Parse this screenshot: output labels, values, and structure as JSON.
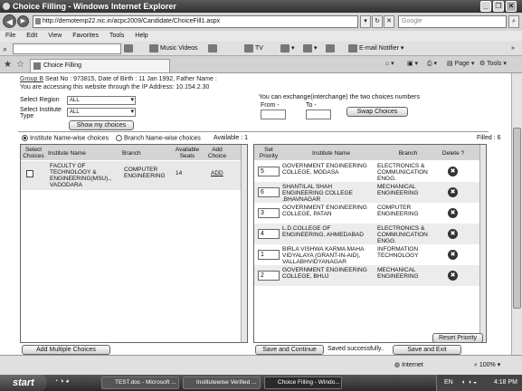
{
  "window": {
    "title": "Choice Filling - Windows Internet Explorer"
  },
  "address": {
    "url": "http://demotemp22.nic.in/acpc2009/Candidate/ChoiceFill1.aspx",
    "search_placeholder": "Google"
  },
  "menu": [
    "File",
    "Edit",
    "View",
    "Favorites",
    "Tools",
    "Help"
  ],
  "toolbar": {
    "music_videos": "Music Videos",
    "tv": "TV",
    "email_notifier": "E-mail Notifier"
  },
  "tab": {
    "title": "Choice Filling"
  },
  "commandbar": {
    "page": "Page",
    "tools": "Tools"
  },
  "info": {
    "group": "Group B",
    "line1_rest": " Seat No : 973815,    Date of Birth : 11 Jan 1992,   Father Name :",
    "line2": "You are accessing this website through the IP Address: 10.154.2.30"
  },
  "filters": {
    "region_label": "Select Region",
    "region_value": "ALL",
    "inst_type_label_1": "Select Institute",
    "inst_type_label_2": "Type",
    "inst_type_value": "ALL",
    "show_button": "Show my choices"
  },
  "exchange": {
    "note": "You can exchange(interchange) the two choices numbers",
    "from_label": "From -",
    "to_label": "To -",
    "swap_button": "Swap Choices"
  },
  "radios": {
    "institute_wise": "Institute Name-wise choices",
    "branch_wise": "Branch Name-wise choices",
    "available": "Available : 1",
    "filled": "Filled : 6"
  },
  "available_table": {
    "headers": [
      "Select\nChoices",
      "Institute Name",
      "Branch",
      "Available\nSeats",
      "Add\nChoice"
    ],
    "rows": [
      {
        "institute": "FACULTY OF TECHNOLOGY & ENGINEERING(MSU)., VADODARA",
        "branch": "COMPUTER ENGINEERING",
        "seats": "14",
        "add": "ADD"
      }
    ]
  },
  "choices_table": {
    "headers": [
      "Set\nPriority",
      "Institute Name",
      "Branch",
      "Delete ?"
    ],
    "rows": [
      {
        "priority": "5",
        "institute": "GOVERNMENT ENGINEERING COLLEGE, MODASA",
        "branch": "ELECTRONICS & COMMUNICATION ENGG."
      },
      {
        "priority": "6",
        "institute": "SHANTILAL SHAH ENGINEERING COLLEGE ,BHAVNAGAR",
        "branch": "MECHANICAL ENGINEERING"
      },
      {
        "priority": "3",
        "institute": "GOVERNMENT ENGINEERING COLLEGE, PATAN",
        "branch": "COMPUTER ENGINEERING"
      },
      {
        "priority": "4",
        "institute": "L.D.COLLEGE OF ENGINEERING, AHMEDABAD",
        "branch": "ELECTRONICS & COMMUNICATION ENGG."
      },
      {
        "priority": "1",
        "institute": "BIRLA VISHWA KARMA MAHA VIDYALAYA (GRANT-IN-AID), VALLABHVIDYANAGAR",
        "branch": "INFORMATION TECHNOLOGY"
      },
      {
        "priority": "2",
        "institute": "GOVERNMENT ENGINEERING COLLEGE, BHUJ",
        "branch": "MECHANICAL ENGINEERING"
      }
    ]
  },
  "actions": {
    "add_multiple": "Add Multiple Choices",
    "reset_priority": "Reset Priority",
    "save_continue": "Save and Continue",
    "saved_msg": "Saved successfully..",
    "save_exit": "Save and Exit"
  },
  "status": {
    "zone": "Internet",
    "zoom": "100%"
  },
  "taskbar": {
    "start": "start",
    "tasks": [
      "TEST.doc - Microsoft ...",
      "Institutewise Verified ...",
      "Choice Filling - Windo..."
    ],
    "lang": "EN",
    "clock": "4:18 PM"
  }
}
